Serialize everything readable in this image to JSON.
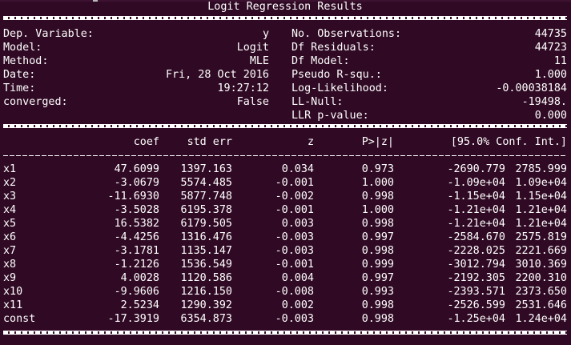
{
  "title": "Logit Regression Results",
  "info_left": [
    {
      "label": "Dep. Variable:",
      "value": "y"
    },
    {
      "label": "Model:",
      "value": "Logit"
    },
    {
      "label": "Method:",
      "value": "MLE"
    },
    {
      "label": "Date:",
      "value": "Fri, 28 Oct 2016"
    },
    {
      "label": "Time:",
      "value": "19:27:12"
    },
    {
      "label": "converged:",
      "value": "False"
    },
    {
      "label": "",
      "value": ""
    }
  ],
  "info_right": [
    {
      "label": "No. Observations:",
      "value": "44735"
    },
    {
      "label": "Df Residuals:",
      "value": "44723"
    },
    {
      "label": "Df Model:",
      "value": "11"
    },
    {
      "label": "Pseudo R-squ.:",
      "value": "1.000"
    },
    {
      "label": "Log-Likelihood:",
      "value": "-0.00038184"
    },
    {
      "label": "LL-Null:",
      "value": "-19498."
    },
    {
      "label": "LLR p-value:",
      "value": "0.000"
    }
  ],
  "coef_headers": {
    "coef": "coef",
    "std_err": "std err",
    "z": "z",
    "p": "P>|z|",
    "conf": "[95.0% Conf. Int.]"
  },
  "coef_rows": [
    {
      "name": "x1",
      "coef": "47.6099",
      "std_err": "1397.163",
      "z": "0.034",
      "p": "0.973",
      "lo": "-2690.779",
      "hi": "2785.999"
    },
    {
      "name": "x2",
      "coef": "-3.0679",
      "std_err": "5574.485",
      "z": "-0.001",
      "p": "1.000",
      "lo": "-1.09e+04",
      "hi": "1.09e+04"
    },
    {
      "name": "x3",
      "coef": "-11.6930",
      "std_err": "5877.748",
      "z": "-0.002",
      "p": "0.998",
      "lo": "-1.15e+04",
      "hi": "1.15e+04"
    },
    {
      "name": "x4",
      "coef": "-3.5028",
      "std_err": "6195.378",
      "z": "-0.001",
      "p": "1.000",
      "lo": "-1.21e+04",
      "hi": "1.21e+04"
    },
    {
      "name": "x5",
      "coef": "16.5382",
      "std_err": "6179.505",
      "z": "0.003",
      "p": "0.998",
      "lo": "-1.21e+04",
      "hi": "1.21e+04"
    },
    {
      "name": "x6",
      "coef": "-4.4256",
      "std_err": "1316.476",
      "z": "-0.003",
      "p": "0.997",
      "lo": "-2584.670",
      "hi": "2575.819"
    },
    {
      "name": "x7",
      "coef": "-3.1781",
      "std_err": "1135.147",
      "z": "-0.003",
      "p": "0.998",
      "lo": "-2228.025",
      "hi": "2221.669"
    },
    {
      "name": "x8",
      "coef": "-1.2126",
      "std_err": "1536.549",
      "z": "-0.001",
      "p": "0.999",
      "lo": "-3012.794",
      "hi": "3010.369"
    },
    {
      "name": "x9",
      "coef": "4.0028",
      "std_err": "1120.586",
      "z": "0.004",
      "p": "0.997",
      "lo": "-2192.305",
      "hi": "2200.310"
    },
    {
      "name": "x10",
      "coef": "-9.9606",
      "std_err": "1216.150",
      "z": "-0.008",
      "p": "0.993",
      "lo": "-2393.571",
      "hi": "2373.650"
    },
    {
      "name": "x11",
      "coef": "2.5234",
      "std_err": "1290.392",
      "z": "0.002",
      "p": "0.998",
      "lo": "-2526.599",
      "hi": "2531.646"
    },
    {
      "name": "const",
      "coef": "-17.3919",
      "std_err": "6354.873",
      "z": "-0.003",
      "p": "0.998",
      "lo": "-1.25e+04",
      "hi": "1.24e+04"
    }
  ],
  "colors": {
    "background": "#300a24",
    "text": "#ffffff"
  }
}
